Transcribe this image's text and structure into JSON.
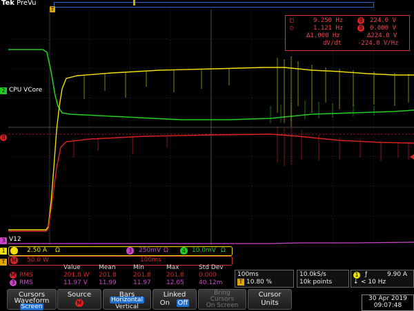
{
  "header": {
    "brand": "Tek",
    "mode": "PreVu",
    "trigger_marker": "T"
  },
  "cursor_readout": {
    "a_freq": "9.250 Hz",
    "a_val": "224.0 V",
    "b_freq": "1.121 Hz",
    "b_val": "0.000 V",
    "delta_freq": "Δ1.000 Hz",
    "delta_val": "Δ224.0 V",
    "rate_label": "dV/dt",
    "rate_val": "-224.0 V/Hz"
  },
  "channel_labels": {
    "ch2_name": "CPU VCore",
    "ch2_num": "2",
    "math_num": "B",
    "ref_num": "3",
    "v12_name": "V12",
    "ch1_num": "1",
    "trig_ch": "T"
  },
  "scales": {
    "ch1": "2.50 A",
    "ch1_sfx": "Ω",
    "ch3_num": "3",
    "ch3": "250mV",
    "ch3_sfx": "Ω",
    "ch4_num": "4",
    "ch4": "10.0mV",
    "ch4_sfx": "Ω",
    "math_num": "M",
    "math": "50.0 W",
    "math_time": "100ms"
  },
  "measurements": {
    "headers": [
      "Value",
      "Mean",
      "Min",
      "Max",
      "Std Dev"
    ],
    "rows": [
      {
        "ch": "M",
        "label": "RMS",
        "value": "201.8 W",
        "mean": "201.8",
        "min": "201.8",
        "max": "201.8",
        "std": "0.000"
      },
      {
        "ch": "3",
        "label": "RMS",
        "value": "11.97 V",
        "mean": "11.99",
        "min": "11.97",
        "max": "12.05",
        "std": "40.12m"
      }
    ]
  },
  "timebase": {
    "scale": "100ms",
    "trig_pos": "10.80 %"
  },
  "acquisition": {
    "rate": "10.0kS/s",
    "points": "10k points"
  },
  "trigger": {
    "ch": "1",
    "slope": "ƒ",
    "level": "9.90 A",
    "filter": "< 10 Hz"
  },
  "menu": {
    "cursors": {
      "l1": "Cursors",
      "l2": "Waveform",
      "l3": "Screen"
    },
    "source": {
      "l1": "Source",
      "l2": "M"
    },
    "bars": {
      "l1": "Bars",
      "l2": "Horizontal",
      "l3": "Vertical"
    },
    "linked": {
      "l1": "Linked",
      "on": "On",
      "off": "Off"
    },
    "bring": {
      "l1": "Bring",
      "l2": "Cursors",
      "l3": "On Screen"
    },
    "units": {
      "l1": "Cursor",
      "l2": "Units"
    }
  },
  "datetime": {
    "date": "30 Apr 2019",
    "time": "09:07:48"
  },
  "colors": {
    "ch1": "#f0e000",
    "ch2": "#22cc22",
    "ch3": "#cc44cc",
    "math": "#dd2222",
    "ref": "#e0a800"
  }
}
